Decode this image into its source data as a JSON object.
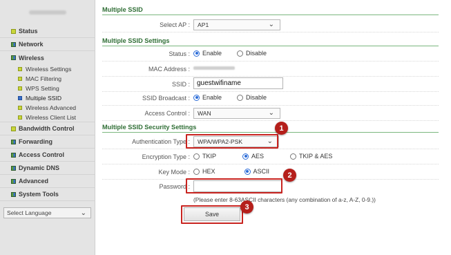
{
  "sidebar": {
    "menu": [
      {
        "label": "Status",
        "icon": "status-icon"
      },
      {
        "label": "Network",
        "icon": "network-icon"
      },
      {
        "label": "Wireless",
        "icon": "wireless-icon"
      }
    ],
    "wireless_sub": [
      "Wireless Settings",
      "MAC Filtering",
      "WPS Setting",
      "Multiple SSID",
      "Wireless Advanced",
      "Wireless Client List"
    ],
    "menu_after": [
      {
        "label": "Bandwidth Control",
        "icon": "bandwidth-icon"
      },
      {
        "label": "Forwarding",
        "icon": "forwarding-icon"
      },
      {
        "label": "Access Control",
        "icon": "access-control-icon"
      },
      {
        "label": "Dynamic DNS",
        "icon": "ddns-icon"
      },
      {
        "label": "Advanced",
        "icon": "advanced-icon"
      },
      {
        "label": "System Tools",
        "icon": "system-tools-icon"
      }
    ],
    "language_select": "Select Language"
  },
  "main": {
    "section1": "Multiple SSID",
    "select_ap_label": "Select AP :",
    "select_ap_value": "AP1",
    "section2": "Multiple SSID Settings",
    "status_label": "Status :",
    "status_enable": "Enable",
    "status_disable": "Disable",
    "mac_label": "MAC Address :",
    "ssid_label": "SSID :",
    "ssid_value": "guestwifiname",
    "broadcast_label": "SSID Broadcast :",
    "broadcast_enable": "Enable",
    "broadcast_disable": "Disable",
    "access_label": "Access Control :",
    "access_value": "WAN",
    "section3": "Multiple SSID Security Settings",
    "auth_label": "Authentication Type :",
    "auth_value": "WPA/WPA2-PSK",
    "enc_label": "Encryption Type :",
    "enc_tkip": "TKIP",
    "enc_aes": "AES",
    "enc_tkip_aes": "TKIP & AES",
    "keymode_label": "Key Mode :",
    "keymode_hex": "HEX",
    "keymode_ascii": "ASCII",
    "password_label": "Password :",
    "password_value": "",
    "hint": "(Please enter 8-63ASCII characters (any combination of a-z, A-Z, 0-9.))",
    "save_label": "Save"
  },
  "annotations": {
    "badge1": "1",
    "badge2": "2",
    "badge3": "3",
    "highlight_color": "#c8231f",
    "badge_color": "#b51f1b"
  }
}
